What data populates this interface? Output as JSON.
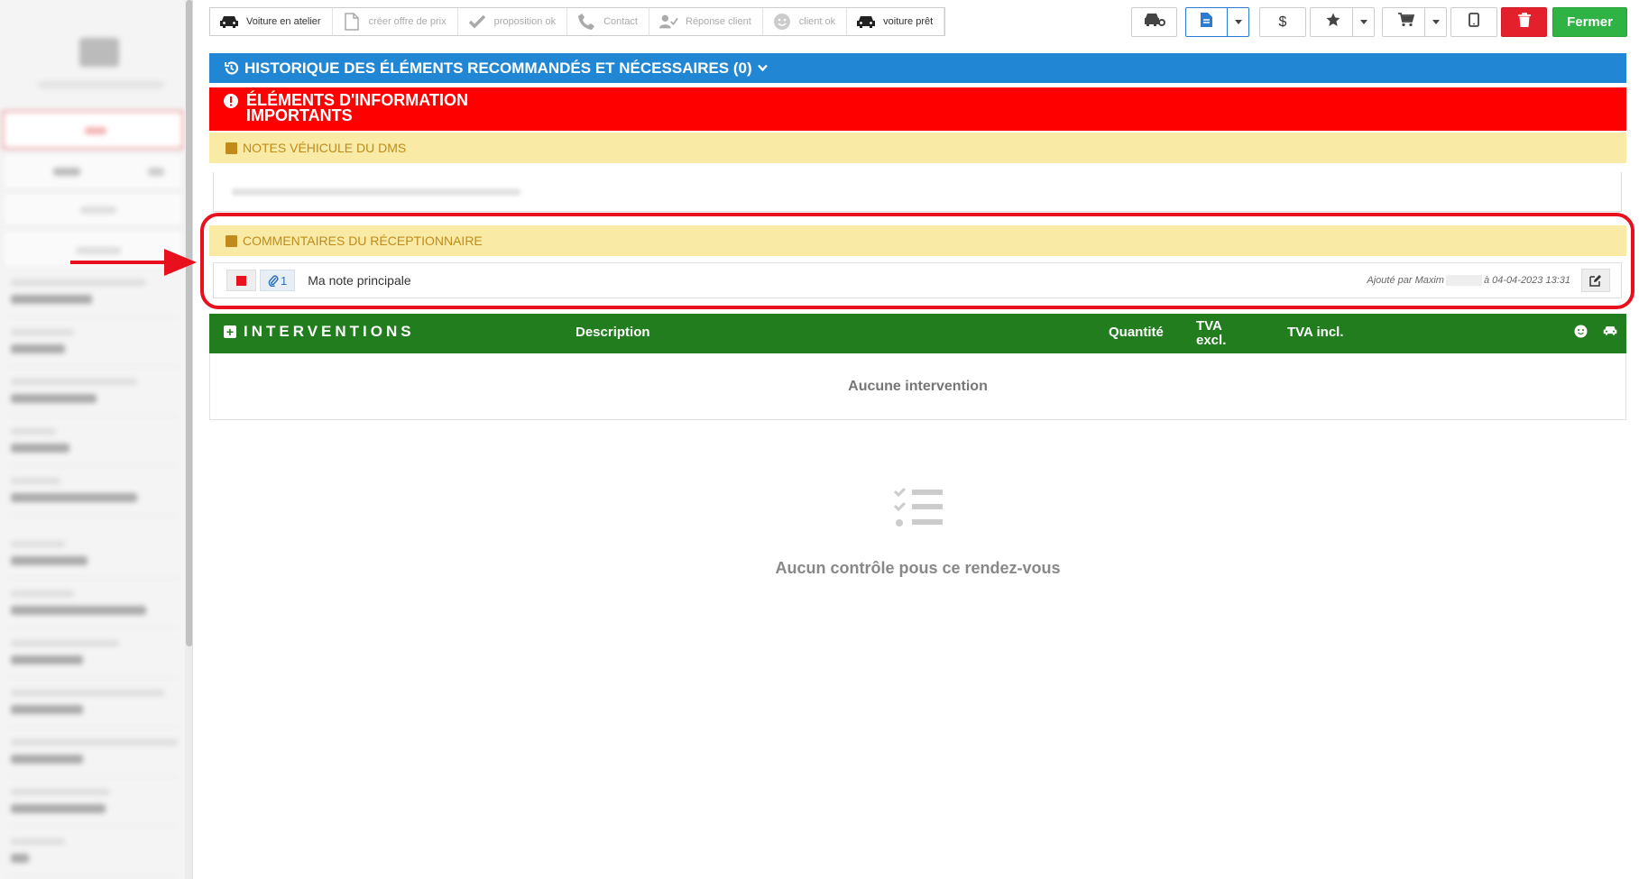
{
  "status_steps": [
    {
      "label": "Voiture en atelier",
      "icon": "car-icon",
      "active": true
    },
    {
      "label": "créer offre de prix",
      "icon": "document-icon",
      "active": false
    },
    {
      "label": "proposition ok",
      "icon": "check-icon",
      "active": false
    },
    {
      "label": "Contact",
      "icon": "phone-icon",
      "active": false
    },
    {
      "label": "Réponse client",
      "icon": "user-check-icon",
      "active": false
    },
    {
      "label": "client ok",
      "icon": "smile-icon",
      "active": false
    },
    {
      "label": "voiture prêt",
      "icon": "car-icon",
      "active": true
    }
  ],
  "toolbar": {
    "dollar_label": "$",
    "close_label": "Fermer"
  },
  "history_bar": {
    "label": "HISTORIQUE DES ÉLÉMENTS RECOMMANDÉS ET NÉCESSAIRES (0)"
  },
  "important_bar": {
    "label": "ÉLÉMENTS D'INFORMATION IMPORTANTS"
  },
  "dms_notes": {
    "label": "NOTES VÉHICULE DU DMS"
  },
  "receptionist_comments": {
    "label": "COMMENTAIRES DU RÉCEPTIONNAIRE",
    "note": {
      "attachment_count": "1",
      "text": "Ma note principale",
      "added_by_prefix": "Ajouté par Maxim",
      "added_at": "à 04-04-2023 13:31"
    }
  },
  "interventions": {
    "title": "INTERVENTIONS",
    "columns": {
      "description": "Description",
      "quantity": "Quantité",
      "tva_excl": "TVA excl.",
      "tva_incl": "TVA incl."
    },
    "empty_text": "Aucune intervention"
  },
  "checks": {
    "empty_text": "Aucun contrôle pous ce rendez-vous"
  },
  "colors": {
    "history_blue": "#2187d4",
    "important_red": "#ff0000",
    "notes_yellow": "#f9eaa5",
    "interventions_green": "#227d1e",
    "close_green": "#2fb344",
    "delete_red": "#e4202c",
    "highlight_red": "#e8101c"
  }
}
